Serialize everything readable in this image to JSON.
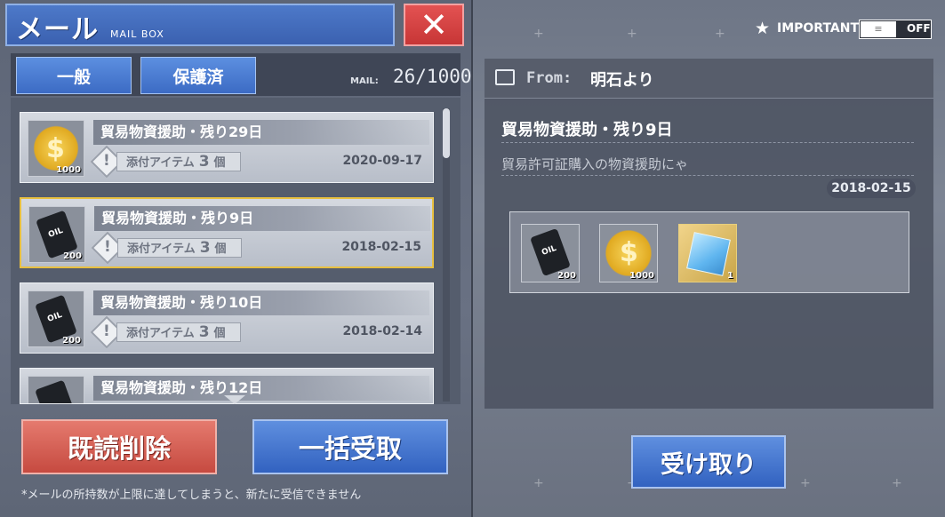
{
  "header": {
    "title": "メール",
    "subtitle": "MAIL BOX",
    "close_icon": "close-icon"
  },
  "tabs": [
    {
      "label": "一般",
      "active": true
    },
    {
      "label": "保護済",
      "active": false
    }
  ],
  "mail_count": {
    "label": "MAIL:",
    "value": "26/1000"
  },
  "mails": [
    {
      "title": "貿易物資援助・残り29日",
      "attach_prefix": "添付アイテム",
      "attach_count": "3",
      "attach_suffix": "個",
      "date": "2020-09-17",
      "thumb": "gold-coin",
      "thumb_count": "1000",
      "selected": false
    },
    {
      "title": "貿易物資援助・残り9日",
      "attach_prefix": "添付アイテム",
      "attach_count": "3",
      "attach_suffix": "個",
      "date": "2018-02-15",
      "thumb": "oil-barrel",
      "thumb_count": "200",
      "selected": true
    },
    {
      "title": "貿易物資援助・残り10日",
      "attach_prefix": "添付アイテム",
      "attach_count": "3",
      "attach_suffix": "個",
      "date": "2018-02-14",
      "thumb": "oil-barrel",
      "thumb_count": "200",
      "selected": false
    },
    {
      "title": "貿易物資援助・残り12日",
      "thumb": "oil-barrel"
    }
  ],
  "buttons": {
    "delete_read": "既読削除",
    "collect_all": "一括受取",
    "claim": "受け取り"
  },
  "footnote": "*メールの所持数が上限に達してしまうと、新たに受信できません",
  "important": {
    "label": "IMPORTANT",
    "toggle_state": "OFF",
    "toggle_knob": "≡"
  },
  "detail": {
    "from_label": "From:",
    "from_name": "明石より",
    "title": "貿易物資援助・残り9日",
    "body": "貿易許可証購入の物資援助にゃ",
    "date": "2018-02-15",
    "rewards": [
      {
        "icon": "oil-barrel",
        "count": "200"
      },
      {
        "icon": "gold-coin",
        "count": "1000"
      },
      {
        "icon": "blue-cube",
        "count": "1"
      }
    ]
  },
  "colors": {
    "accent_blue": "#3c6bc4",
    "accent_red": "#c64a40",
    "selected_border": "#e8c040",
    "gold": "#e0b63a"
  }
}
